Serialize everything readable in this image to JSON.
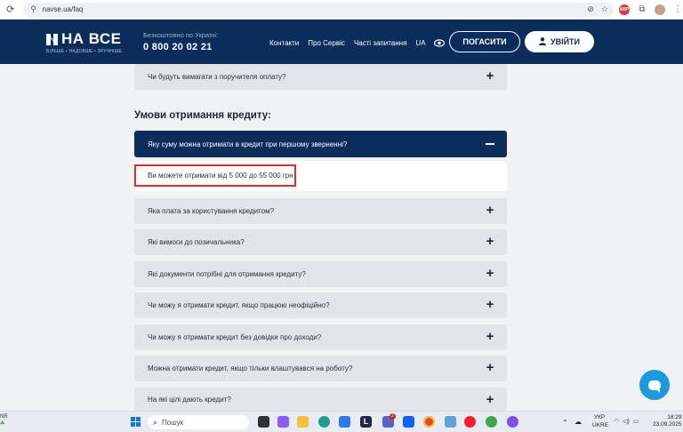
{
  "browser": {
    "url": "navse.ua/faq",
    "ext_abp": "ABP"
  },
  "header": {
    "logo_main": "НА ВСЕ",
    "logo_sub": "БІЛЬШЕ • НАДОВШЕ • ЗРУЧНІШЕ",
    "phone_label": "Безкоштовно по Україні:",
    "phone_number": "0 800 20 02 21",
    "nav": [
      "Контакти",
      "Про Сервіс",
      "Часті запитання",
      "UA"
    ],
    "pay_button": "ПОГАСИТИ",
    "login_button": "УВІЙТИ"
  },
  "faq": {
    "top_question": "Чи будуть вимагати з поручителя оплату?",
    "section_title": "Умови отримання кредиту:",
    "open_question": "Яку суму можна отримати в кредит при першому зверненні?",
    "open_answer": "Ви можете отримати від 5 000 до 55 000 грн",
    "questions": [
      "Яка плата за користування кредитом?",
      "Які вимоги до позичальника?",
      "Які документи потрібні для отримання кредиту?",
      "Чи можу я отримати кредит, якщо працюю неофіційно?",
      "Чи можу я отримати кредит без довідки про доходи?",
      "Можна отримати кредит, якщо тільки влаштувався на роботу?",
      "На які цілі дають кредит?"
    ]
  },
  "taskbar": {
    "weather_line1": "NR",
    "search_placeholder": "Пошук",
    "lang_line1": "УКР",
    "lang_line2": "UKRE",
    "time": "18:29",
    "date": "23.09.2025",
    "badge": "2"
  },
  "colors": {
    "brand_navy": "#0b2d5c",
    "highlight_red": "#e32b2b",
    "chat_blue": "#1a9ae0"
  }
}
